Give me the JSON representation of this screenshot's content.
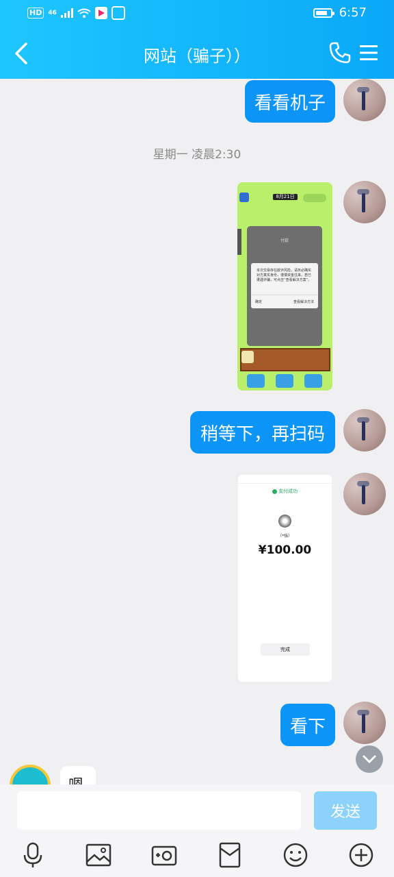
{
  "status_bar": {
    "left_badges": [
      "HD",
      "46"
    ],
    "time": "6:57",
    "battery_level": 0.8
  },
  "header": {
    "title": "网站（骗子））",
    "back_icon": "chevron-left-icon",
    "phone_icon": "phone-icon",
    "menu_icon": "menu-icon"
  },
  "messages": [
    {
      "type": "text",
      "text": "看看机子"
    },
    {
      "type": "timestamp",
      "text": "星期一 凌晨2:30"
    },
    {
      "type": "image",
      "desc_icon": "game-screenshot",
      "game": {
        "date_pill": "8月21日",
        "dialog_title": "付款",
        "dialog_msg": "本次交易存在欺诈风险，请务必确实对方真实身份，谨慎资金往来。若已遭遇诈骗，可点击“查看解决方案”。",
        "ok": "确定",
        "solution": "查看解决方法"
      }
    },
    {
      "type": "text",
      "text": "稍等下，再扫码"
    },
    {
      "type": "image",
      "desc_icon": "payment-screenshot",
      "payment": {
        "status": "支付成功",
        "payee": "（*強）",
        "amount": "¥100.00",
        "done": "完成"
      }
    },
    {
      "type": "text",
      "text": "看下"
    }
  ],
  "peek_text": "嗯",
  "input": {
    "placeholder": "",
    "value": "",
    "send_label": "发送"
  },
  "toolbar": [
    "microphone-icon",
    "image-icon",
    "camera-icon",
    "red-packet-icon",
    "emoji-icon",
    "plus-icon"
  ],
  "colors": {
    "header": "#0aa8f7",
    "bubble": "#0c95f6",
    "send_disabled": "#8dd2fb"
  }
}
